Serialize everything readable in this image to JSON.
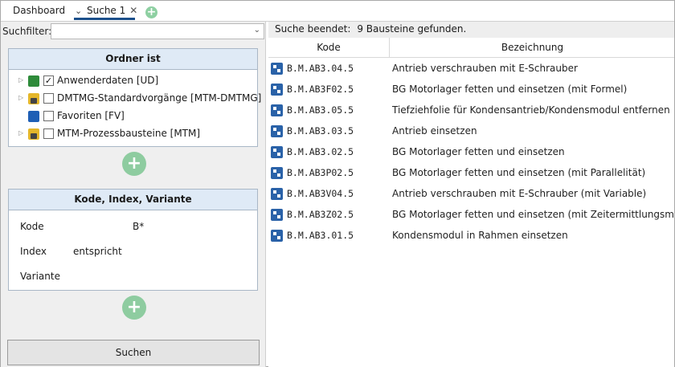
{
  "tabs": {
    "dashboard": "Dashboard",
    "suche": "Suche 1",
    "close_glyph": "✕",
    "add_glyph": "+"
  },
  "filter": {
    "label": "Suchfilter:",
    "value": ""
  },
  "ordner_box": {
    "title": "Ordner ist",
    "items": [
      {
        "label": "Anwenderdaten [UD]",
        "checked": true,
        "icon": "folder-green-icon",
        "expandable": true
      },
      {
        "label": "DMTMG-Standardvorgänge [MTM-DMTMG]",
        "checked": false,
        "icon": "folder-yellow-lock-icon",
        "expandable": true
      },
      {
        "label": "Favoriten [FV]",
        "checked": false,
        "icon": "folder-blue-icon",
        "expandable": false
      },
      {
        "label": "MTM-Prozessbausteine [MTM]",
        "checked": false,
        "icon": "folder-yellow-lock-icon",
        "expandable": true
      }
    ]
  },
  "kiv_box": {
    "title": "Kode, Index, Variante",
    "kode_label": "Kode",
    "kode_value": "B*",
    "index_label": "Index",
    "index_value": "entspricht",
    "variante_label": "Variante",
    "variante_value": ""
  },
  "search_button": "Suchen",
  "status": {
    "label": "Suche beendet:",
    "count_text": "9 Bausteine gefunden."
  },
  "grid": {
    "col_kode": "Kode",
    "col_bez": "Bezeichnung",
    "rows": [
      {
        "code": "B.M.AB3.04.5",
        "bez": "Antrieb verschrauben mit E-Schrauber"
      },
      {
        "code": "B.M.AB3F02.5",
        "bez": "BG Motorlager fetten und einsetzen (mit Formel)"
      },
      {
        "code": "B.M.AB3.05.5",
        "bez": "Tiefziehfolie für Kondensantrieb/Kondensmodul entfernen"
      },
      {
        "code": "B.M.AB3.03.5",
        "bez": "Antrieb einsetzen"
      },
      {
        "code": "B.M.AB3.02.5",
        "bez": "BG Motorlager fetten und einsetzen"
      },
      {
        "code": "B.M.AB3P02.5",
        "bez": "BG Motorlager fetten und einsetzen (mit Parallelität)"
      },
      {
        "code": "B.M.AB3V04.5",
        "bez": "Antrieb verschrauben mit E-Schrauber (mit Variable)"
      },
      {
        "code": "B.M.AB3Z02.5",
        "bez": "BG Motorlager fetten und einsetzen (mit Zeitermittlungsm.)"
      },
      {
        "code": "B.M.AB3.01.5",
        "bez": "Kondensmodul in Rahmen einsetzen"
      }
    ]
  }
}
